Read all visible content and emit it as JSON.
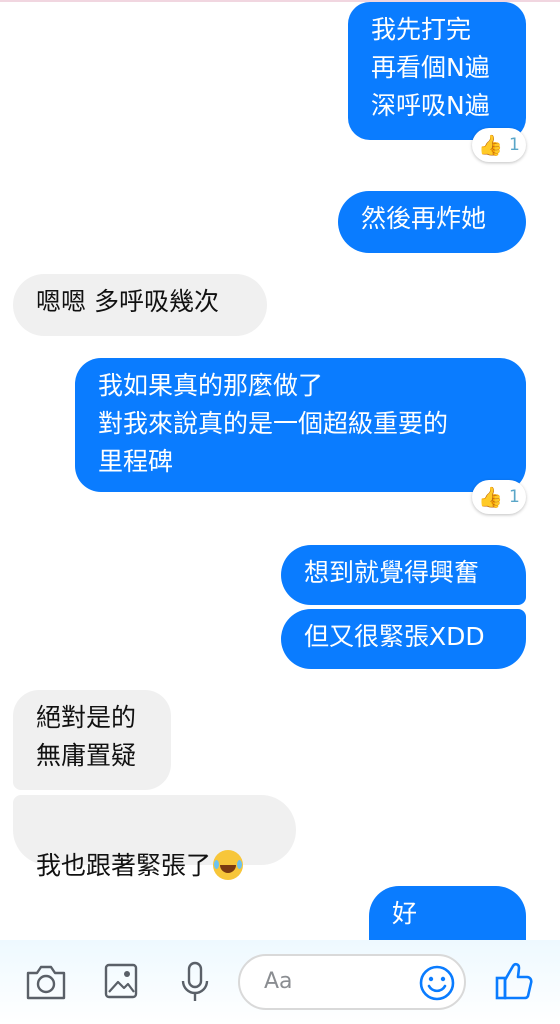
{
  "messages": [
    {
      "id": "m1",
      "side": "out",
      "text": "我先打完\n再看個N遍\n深呼吸N遍",
      "reaction": {
        "count": "1"
      }
    },
    {
      "id": "m2",
      "side": "out",
      "text": "然後再炸她"
    },
    {
      "id": "m3",
      "side": "in",
      "text": "嗯嗯 多呼吸幾次"
    },
    {
      "id": "m4",
      "side": "out",
      "text": "我如果真的那麼做了\n對我來說真的是一個超級重要的\n里程碑",
      "reaction": {
        "count": "1"
      }
    },
    {
      "id": "m5",
      "side": "out",
      "text": "想到就覺得興奮"
    },
    {
      "id": "m6",
      "side": "out",
      "text": "但又很緊張XDD"
    },
    {
      "id": "m7",
      "side": "in",
      "text": "絕對是的\n無庸置疑"
    },
    {
      "id": "m8",
      "side": "in",
      "text": "我也跟著緊張了",
      "emoji": "laughing-tears-emoji"
    },
    {
      "id": "m9",
      "side": "out",
      "text": "好"
    }
  ],
  "reaction_icon": "thumbs-up-emoji",
  "composer": {
    "placeholder": "Aa",
    "icons": [
      "camera-icon",
      "gallery-icon",
      "microphone-icon",
      "smiley-icon",
      "like-icon"
    ]
  },
  "colors": {
    "outgoing_bubble": "#0a7cff",
    "incoming_bubble": "#f0f0f0",
    "accent": "#0a7cff"
  }
}
